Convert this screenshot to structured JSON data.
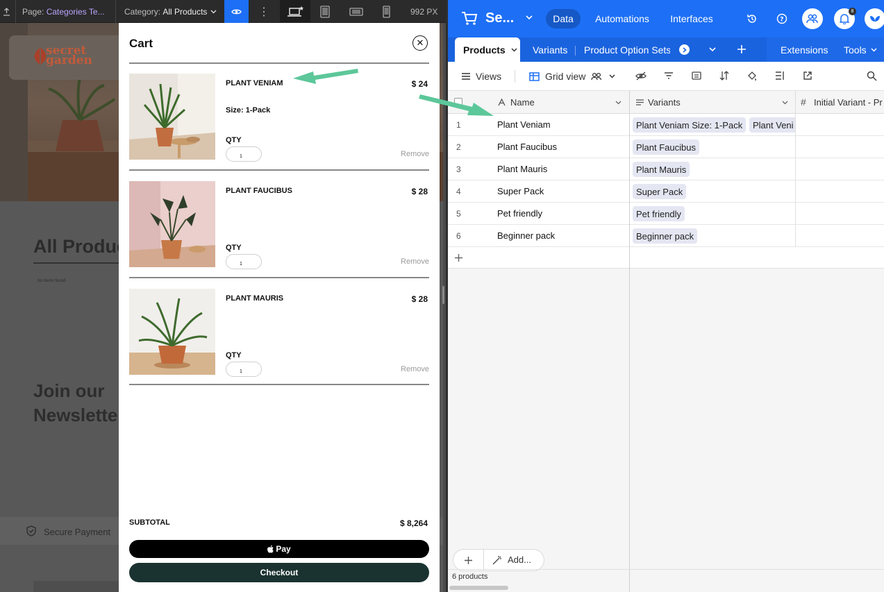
{
  "webflow": {
    "page_label": "Page:",
    "page_value": "Categories Te...",
    "category_label": "Category:",
    "category_value": "All Products",
    "width_value": "992 PX",
    "canvas": {
      "logo_line1": "secret",
      "logo_line2": "garden",
      "heading": "All Produc",
      "empty_text": "No items found.",
      "newsletter_line1": "Join our",
      "newsletter_line2": "Newslette",
      "secure_label": "Secure Payment"
    }
  },
  "cart": {
    "title": "Cart",
    "qty_label": "QTY",
    "remove_label": "Remove",
    "items": [
      {
        "name": "PLANT VENIAM",
        "price": "$ 24",
        "size_label": "Size:",
        "size_value": "1-Pack",
        "qty": "1"
      },
      {
        "name": "PLANT FAUCIBUS",
        "price": "$ 28",
        "qty": "1"
      },
      {
        "name": "PLANT MAURIS",
        "price": "$ 28",
        "qty": "1"
      }
    ],
    "subtotal_label": "SUBTOTAL",
    "subtotal_value": "$ 8,264",
    "applepay_label": "Pay",
    "checkout_label": "Checkout"
  },
  "airtable": {
    "base_name": "Se...",
    "nav": {
      "data": "Data",
      "automations": "Automations",
      "interfaces": "Interfaces"
    },
    "notification_count": "8",
    "tabs": {
      "products": "Products",
      "variants": "Variants",
      "option_sets": "Product Option Sets",
      "extensions": "Extensions",
      "tools": "Tools"
    },
    "toolbar": {
      "views": "Views",
      "grid_view": "Grid view"
    },
    "columns": {
      "name": "Name",
      "variants": "Variants",
      "initial": "Initial Variant - Pr"
    },
    "rows": [
      {
        "num": "1",
        "name": "Plant Veniam",
        "chips": [
          "Plant Veniam Size: 1-Pack",
          "Plant Veni"
        ]
      },
      {
        "num": "2",
        "name": "Plant Faucibus",
        "chips": [
          "Plant Faucibus"
        ]
      },
      {
        "num": "3",
        "name": "Plant Mauris",
        "chips": [
          "Plant Mauris"
        ]
      },
      {
        "num": "4",
        "name": "Super Pack",
        "chips": [
          "Super Pack"
        ]
      },
      {
        "num": "5",
        "name": "Pet friendly",
        "chips": [
          "Pet friendly"
        ]
      },
      {
        "num": "6",
        "name": "Beginner pack",
        "chips": [
          "Beginner pack"
        ]
      }
    ],
    "add_label": "Add...",
    "record_count": "6 products"
  },
  "colors": {
    "airtable_blue": "#1d6ff5",
    "checkout_green": "#1b3330",
    "arrow_green": "#5cc79a",
    "chip_bg": "#e4e6f2"
  }
}
